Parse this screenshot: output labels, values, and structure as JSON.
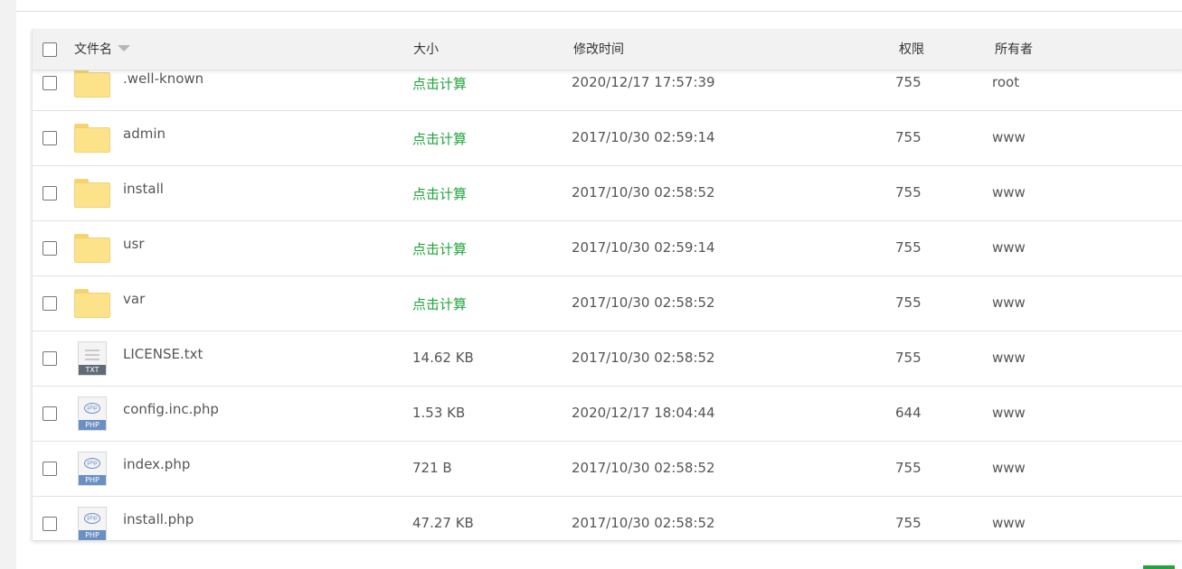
{
  "columns": {
    "name": "文件名",
    "size": "大小",
    "mtime": "修改时间",
    "perm": "权限",
    "owner": "所有者"
  },
  "rows": [
    {
      "name": ".well-known",
      "type": "folder",
      "size": "点击计算",
      "mtime": "2020/12/17 17:57:39",
      "perm": "755",
      "owner": "root"
    },
    {
      "name": "admin",
      "type": "folder",
      "size": "点击计算",
      "mtime": "2017/10/30 02:59:14",
      "perm": "755",
      "owner": "www"
    },
    {
      "name": "install",
      "type": "folder",
      "size": "点击计算",
      "mtime": "2017/10/30 02:58:52",
      "perm": "755",
      "owner": "www"
    },
    {
      "name": "usr",
      "type": "folder",
      "size": "点击计算",
      "mtime": "2017/10/30 02:59:14",
      "perm": "755",
      "owner": "www"
    },
    {
      "name": "var",
      "type": "folder",
      "size": "点击计算",
      "mtime": "2017/10/30 02:58:52",
      "perm": "755",
      "owner": "www"
    },
    {
      "name": "LICENSE.txt",
      "type": "txt",
      "badge": "TXT",
      "size": "14.62 KB",
      "mtime": "2017/10/30 02:58:52",
      "perm": "755",
      "owner": "www"
    },
    {
      "name": "config.inc.php",
      "type": "php",
      "badge": "PHP",
      "size": "1.53 KB",
      "mtime": "2020/12/17 18:04:44",
      "perm": "644",
      "owner": "www"
    },
    {
      "name": "index.php",
      "type": "php",
      "badge": "PHP",
      "size": "721 B",
      "mtime": "2017/10/30 02:58:52",
      "perm": "755",
      "owner": "www"
    },
    {
      "name": "install.php",
      "type": "php",
      "badge": "PHP",
      "size": "47.27 KB",
      "mtime": "2017/10/30 02:58:52",
      "perm": "755",
      "owner": "www"
    }
  ],
  "icons": {
    "folder": "folder-icon",
    "txt": "txt-file-icon",
    "php": "php-file-icon",
    "sort": "sort-down-icon"
  },
  "colors": {
    "accent": "#20a53a",
    "folder": "#fce38a",
    "php": "#6a8fc4",
    "txt": "#5f6a78"
  }
}
